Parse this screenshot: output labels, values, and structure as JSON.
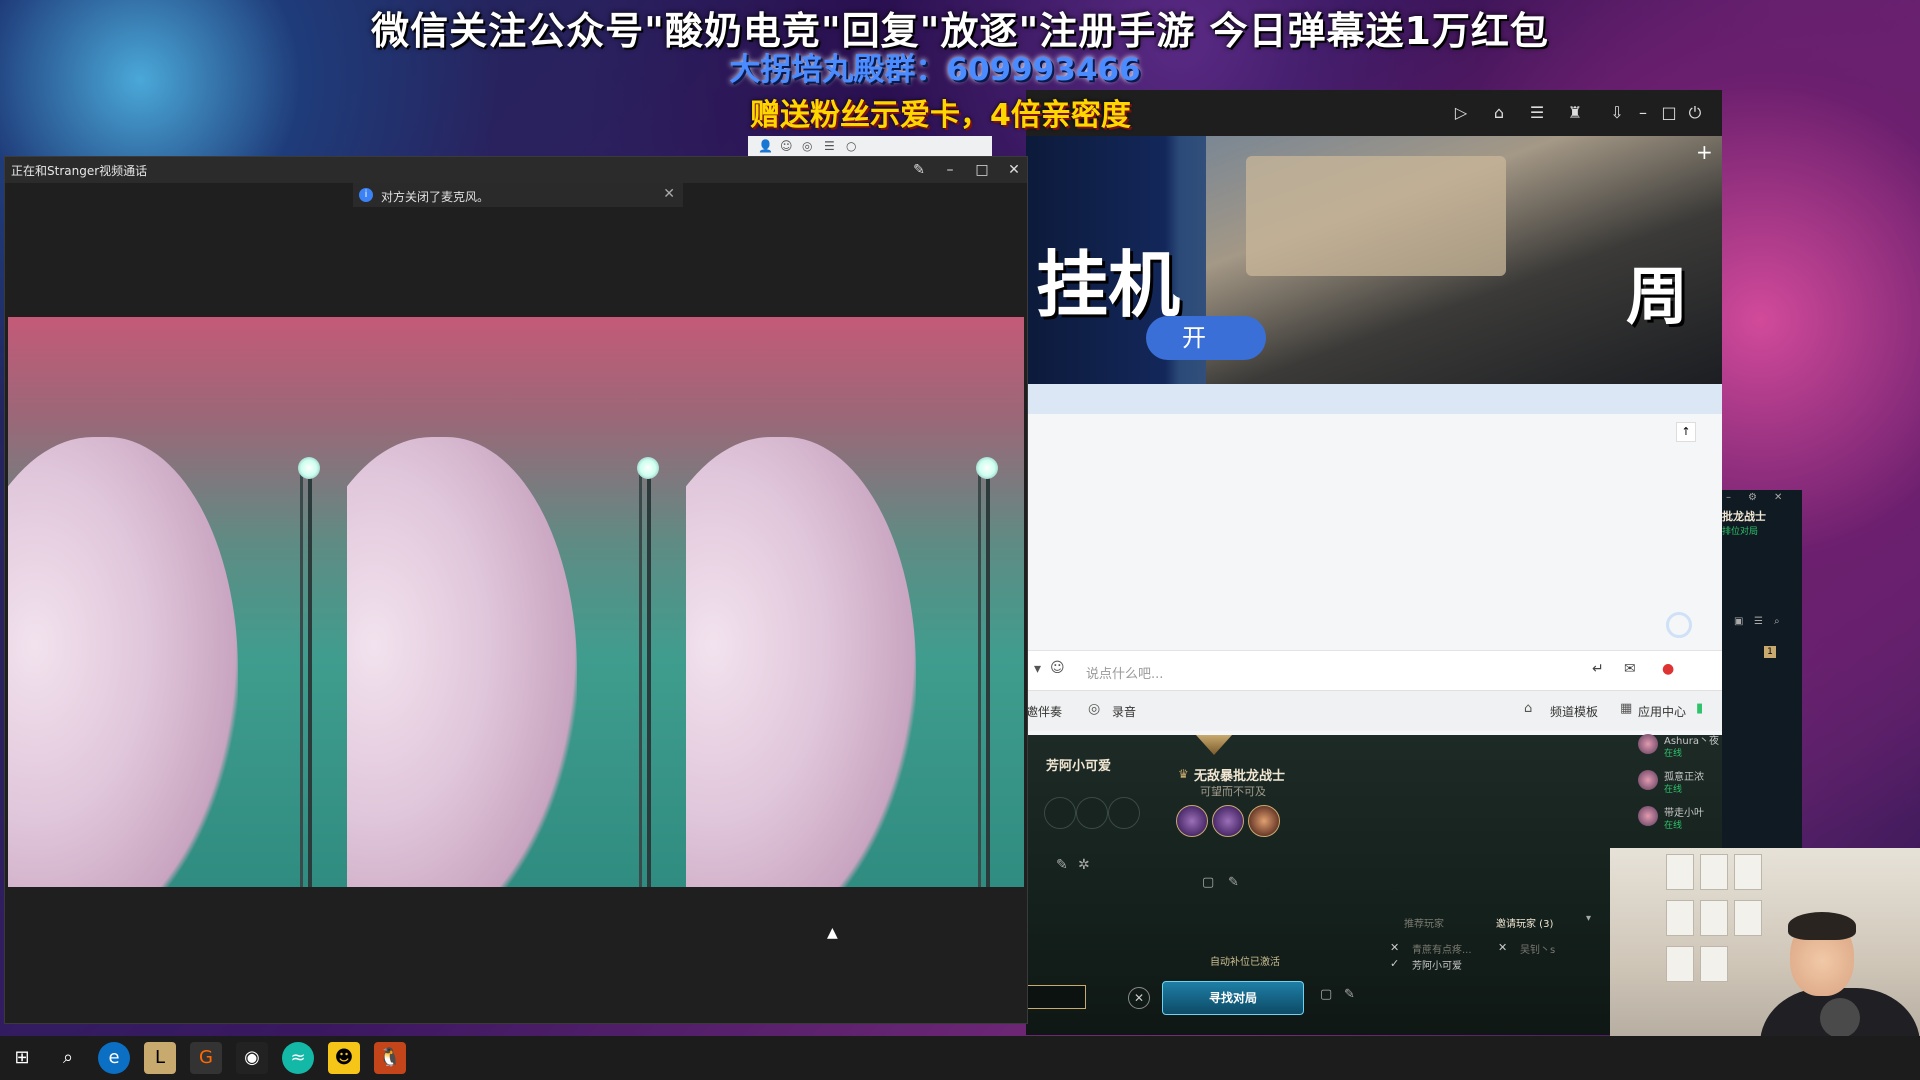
{
  "banners": {
    "line1": "微信关注公众号\"酸奶电竞\"回复\"放逐\"注册手游 今日弹幕送1万红包",
    "line2": "大拐培丸殿群：609993466",
    "line3": "赠送粉丝示爱卡，4倍亲密度"
  },
  "video_call": {
    "title": "正在和Stranger视频通话",
    "toast": "对方关闭了麦克风。"
  },
  "qq_panel": {
    "banner_big_text": "挂机",
    "banner_zhou": "周",
    "banner_button": "开",
    "input_placeholder": "说点什么吧...",
    "footer": {
      "left_label": "邀伴奏",
      "record": "录音",
      "channel_template": "频道模板",
      "app_center": "应用中心"
    }
  },
  "game_client": {
    "player1_name": "芳阿小可爱",
    "player2_name": "无敌暴批龙战士",
    "player2_sub": "可望而不可及",
    "auto_fill": "自动补位已激活",
    "find_match": "寻找对局",
    "invite_tab_recommend": "推荐玩家",
    "invite_tab_invited": "邀请玩家 (3)",
    "invite_list": [
      "青蔗有点疼...",
      "芳阿小可爱",
      "吴钊丶s"
    ]
  },
  "friends": {
    "header_name": "批龙战士",
    "header_sub": "排位对局",
    "badge": "1",
    "items": [
      {
        "name": "Ashura丶夜",
        "status": "在线"
      },
      {
        "name": "孤意正浓",
        "status": "在线"
      },
      {
        "name": "带走小叶",
        "status": "在线"
      }
    ]
  },
  "colors": {
    "accent_gold": "#ffd700",
    "accent_blue": "#4a8bff",
    "online_green": "#2ec36a"
  }
}
